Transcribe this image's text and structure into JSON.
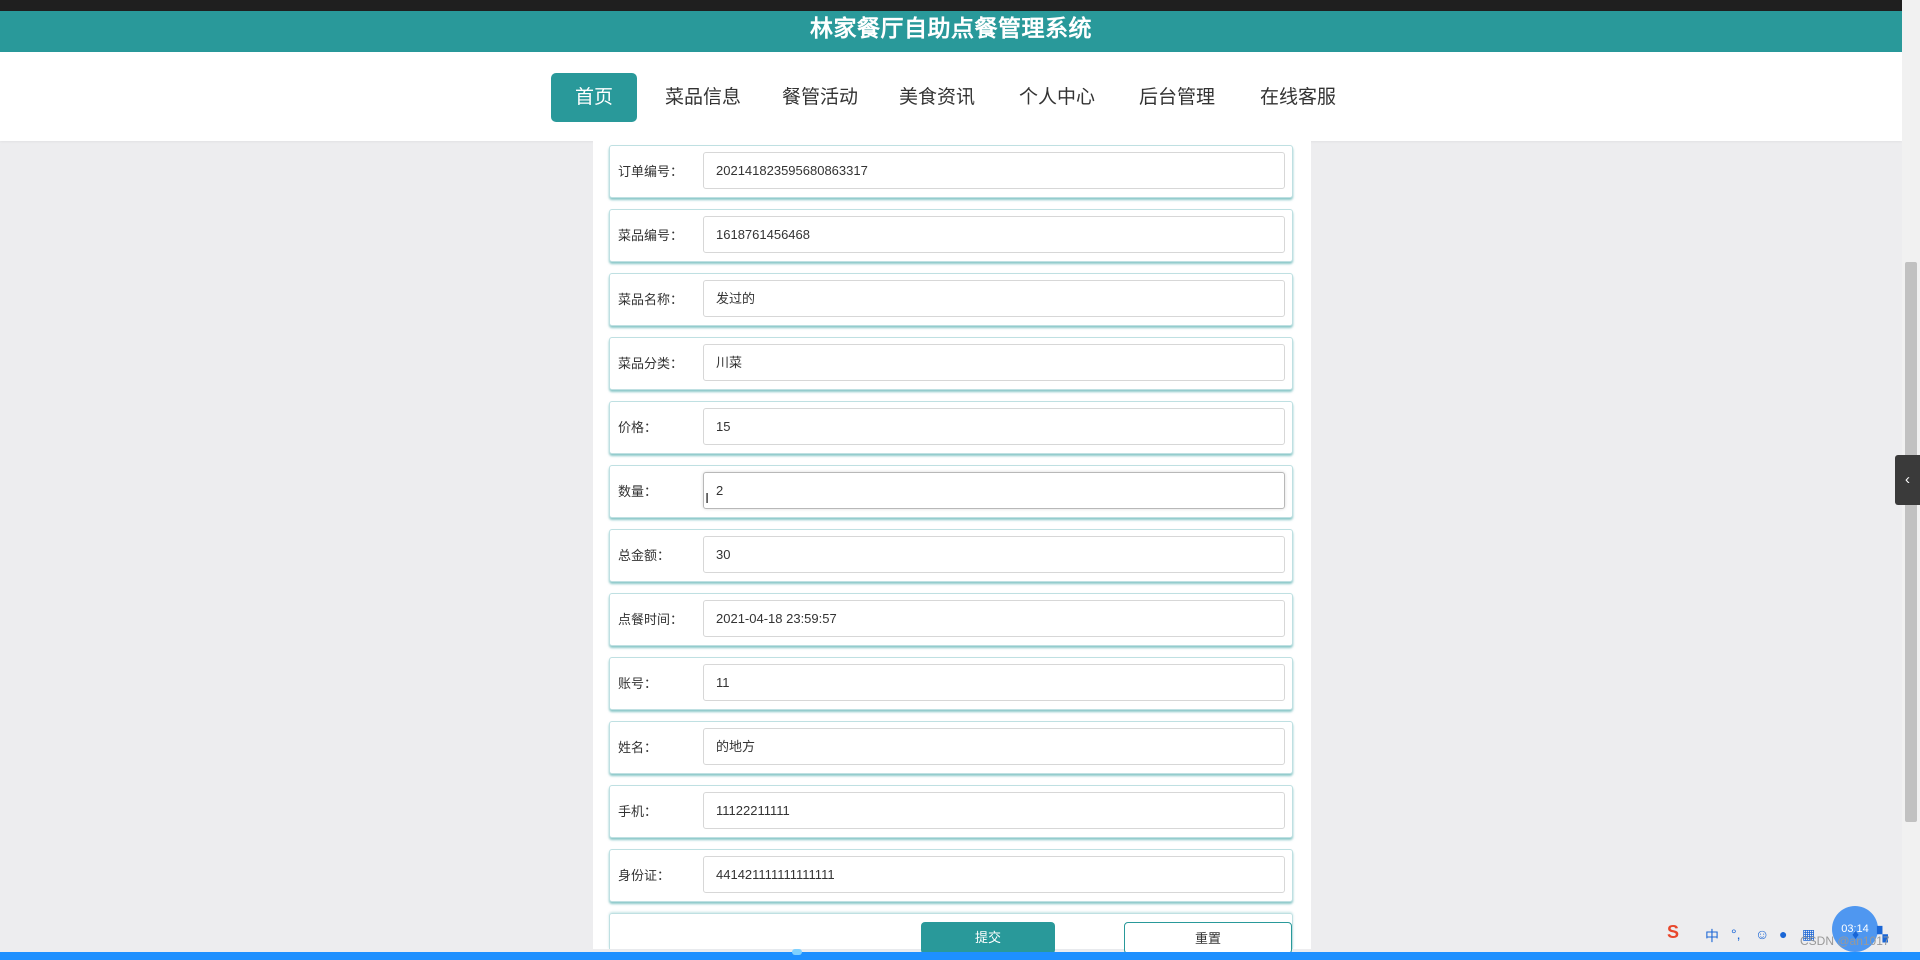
{
  "app": {
    "title": "林家餐厅自助点餐管理系统"
  },
  "nav": {
    "items": [
      {
        "label": "首页",
        "active": true
      },
      {
        "label": "菜品信息"
      },
      {
        "label": "餐管活动"
      },
      {
        "label": "美食资讯"
      },
      {
        "label": "个人中心"
      },
      {
        "label": "后台管理"
      },
      {
        "label": "在线客服"
      }
    ]
  },
  "form": {
    "fields": [
      {
        "label": "订单编号：",
        "value": "202141823595680863317"
      },
      {
        "label": "菜品编号：",
        "value": "1618761456468"
      },
      {
        "label": "菜品名称：",
        "value": "发过的"
      },
      {
        "label": "菜品分类：",
        "value": "川菜"
      },
      {
        "label": "价格：",
        "value": "15"
      },
      {
        "label": "数量：",
        "value": "2"
      },
      {
        "label": "总金额：",
        "value": "30"
      },
      {
        "label": "点餐时间：",
        "value": "2021-04-18 23:59:57"
      },
      {
        "label": "账号：",
        "value": "11"
      },
      {
        "label": "姓名：",
        "value": "的地方"
      },
      {
        "label": "手机：",
        "value": "11122211111"
      },
      {
        "label": "身份证：",
        "value": "441421111111111111"
      }
    ],
    "submit_label": "提交",
    "reset_label": "重置"
  },
  "system": {
    "clock": "03:14",
    "ime_label": "中",
    "watermark": "CSDN @an1017"
  },
  "icons": {
    "side_tab": "chevron-left-icon",
    "cursor": "text-cursor-icon",
    "ime_logo": "sogou-ime-icon"
  },
  "colors": {
    "accent": "#29999a",
    "page_bg": "#ededef"
  }
}
